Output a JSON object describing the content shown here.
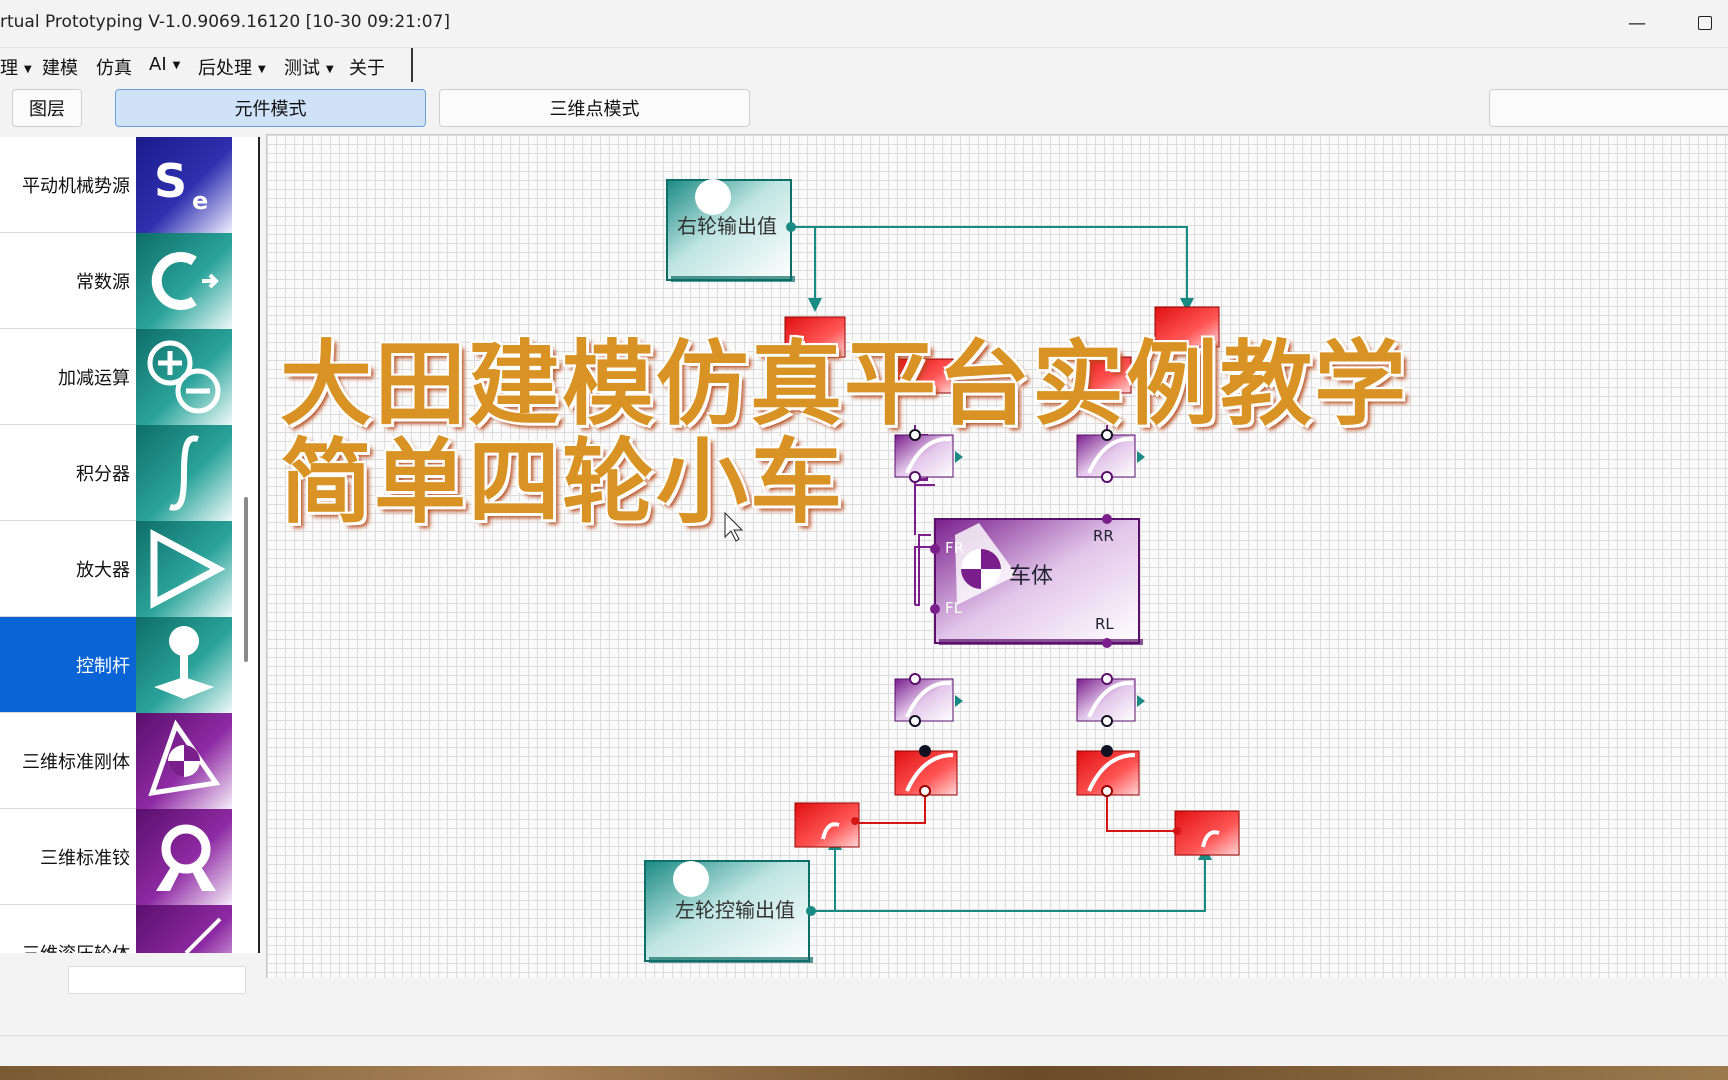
{
  "window": {
    "title": "rtual Prototyping V-1.0.9069.16120 [10-30 09:21:07]"
  },
  "menu": [
    {
      "label": "理",
      "caret": true
    },
    {
      "label": "建模",
      "caret": false
    },
    {
      "label": "仿真",
      "caret": false
    },
    {
      "label": "AI",
      "caret": true
    },
    {
      "label": "后处理",
      "caret": true
    },
    {
      "label": "测试",
      "caret": true
    },
    {
      "label": "关于",
      "caret": false
    }
  ],
  "toolbar": {
    "layers_label": "图层",
    "component_mode_label": "元件模式",
    "point3d_mode_label": "三维点模式"
  },
  "palette": {
    "items": [
      {
        "label": "平动机械势源",
        "icon": "se-source-icon",
        "color": "#2a2aa0"
      },
      {
        "label": "常数源",
        "icon": "constant-source-icon",
        "color": "#1a8a84"
      },
      {
        "label": "加减运算",
        "icon": "add-subtract-icon",
        "color": "#1a8a84"
      },
      {
        "label": "积分器",
        "icon": "integrator-icon",
        "color": "#1a8a84"
      },
      {
        "label": "放大器",
        "icon": "amplifier-icon",
        "color": "#1a8a84"
      },
      {
        "label": "控制杆",
        "icon": "joystick-icon",
        "color": "#1a8a84"
      },
      {
        "label": "三维标准刚体",
        "icon": "rigid-body-icon",
        "color": "#7a1e8c"
      },
      {
        "label": "三维标准铰",
        "icon": "hinge-icon",
        "color": "#7a1e8c"
      },
      {
        "label": "三维滚压轮体",
        "icon": "roller-icon",
        "color": "#7a1e8c"
      }
    ],
    "selected_index": 5
  },
  "diagram": {
    "right_output_label": "右轮输出值",
    "left_output_label": "左轮控输出值",
    "body_label": "车体",
    "ports": {
      "fr": "FR",
      "fl": "FL",
      "rr": "RR",
      "rl": "RL"
    }
  },
  "overlay": {
    "line1": "大田建模仿真平台实例教学",
    "line2": "简单四轮小车"
  }
}
